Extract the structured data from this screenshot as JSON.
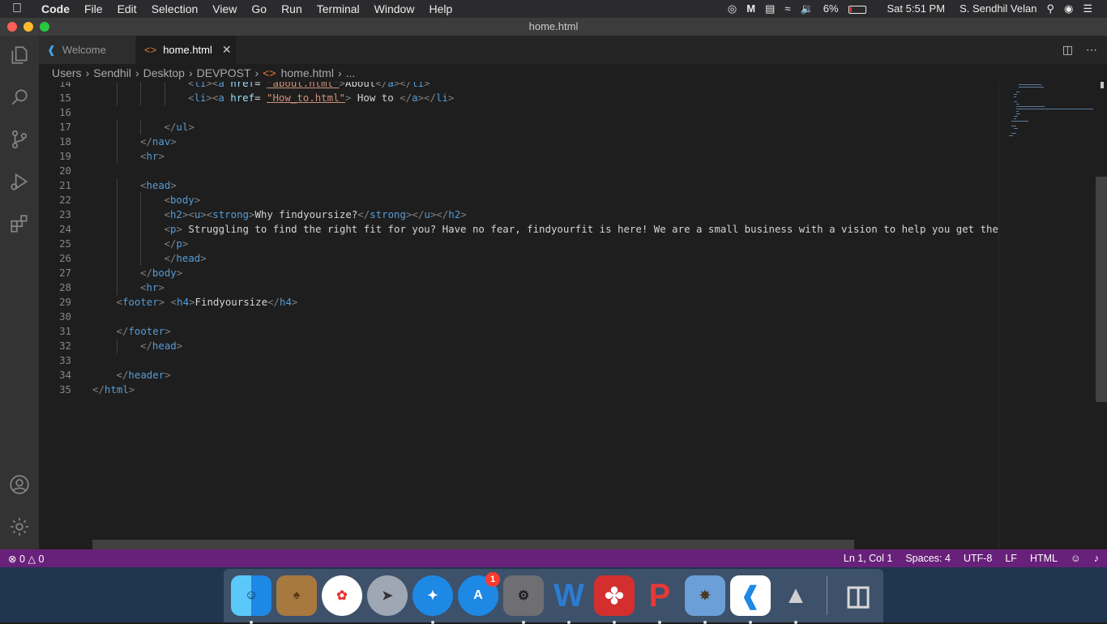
{
  "menubar": {
    "app_name": "Code",
    "menus": [
      "File",
      "Edit",
      "Selection",
      "View",
      "Go",
      "Run",
      "Terminal",
      "Window",
      "Help"
    ],
    "battery_percent": "6%",
    "clock": "Sat 5:51 PM",
    "user": "S. Sendhil Velan"
  },
  "window": {
    "title": "home.html"
  },
  "tabs": [
    {
      "label": "Welcome",
      "icon": "vscode-logo-icon",
      "active": false
    },
    {
      "label": "home.html",
      "icon": "html-file-icon",
      "active": true
    }
  ],
  "breadcrumb": [
    "Users",
    "Sendhil",
    "Desktop",
    "DEVPOST",
    "home.html",
    "..."
  ],
  "editor": {
    "lines": [
      {
        "n": "14",
        "indent": 4,
        "tokens": [
          [
            "br",
            "<"
          ],
          [
            "tag",
            "li"
          ],
          [
            "br",
            ">"
          ],
          [
            "br",
            "<"
          ],
          [
            "tag",
            "a "
          ],
          [
            "attr",
            "href"
          ],
          [
            "txt",
            "= "
          ],
          [
            "str",
            "\"about.html\""
          ],
          [
            "br",
            ">"
          ],
          [
            "txt",
            "About"
          ],
          [
            "br",
            "</"
          ],
          [
            "tag",
            "a"
          ],
          [
            "br",
            "></"
          ],
          [
            "tag",
            "li"
          ],
          [
            "br",
            ">"
          ]
        ]
      },
      {
        "n": "15",
        "indent": 4,
        "tokens": [
          [
            "br",
            "<"
          ],
          [
            "tag",
            "li"
          ],
          [
            "br",
            ">"
          ],
          [
            "br",
            "<"
          ],
          [
            "tag",
            "a "
          ],
          [
            "attr",
            "href"
          ],
          [
            "txt",
            "= "
          ],
          [
            "str",
            "\"How_to.html\""
          ],
          [
            "br",
            ">"
          ],
          [
            "txt",
            " How to "
          ],
          [
            "br",
            "</"
          ],
          [
            "tag",
            "a"
          ],
          [
            "br",
            "></"
          ],
          [
            "tag",
            "li"
          ],
          [
            "br",
            ">"
          ]
        ]
      },
      {
        "n": "16",
        "indent": 0,
        "tokens": []
      },
      {
        "n": "17",
        "indent": 3,
        "tokens": [
          [
            "br",
            "</"
          ],
          [
            "tag",
            "ul"
          ],
          [
            "br",
            ">"
          ]
        ]
      },
      {
        "n": "18",
        "indent": 2,
        "tokens": [
          [
            "br",
            "</"
          ],
          [
            "tag",
            "nav"
          ],
          [
            "br",
            ">"
          ]
        ]
      },
      {
        "n": "19",
        "indent": 2,
        "tokens": [
          [
            "br",
            "<"
          ],
          [
            "tag",
            "hr"
          ],
          [
            "br",
            ">"
          ]
        ]
      },
      {
        "n": "20",
        "indent": 0,
        "tokens": []
      },
      {
        "n": "21",
        "indent": 2,
        "tokens": [
          [
            "br",
            "<"
          ],
          [
            "tag",
            "head"
          ],
          [
            "br",
            ">"
          ]
        ]
      },
      {
        "n": "22",
        "indent": 3,
        "tokens": [
          [
            "br",
            "<"
          ],
          [
            "tag",
            "body"
          ],
          [
            "br",
            ">"
          ]
        ]
      },
      {
        "n": "23",
        "indent": 3,
        "tokens": [
          [
            "br",
            "<"
          ],
          [
            "tag",
            "h2"
          ],
          [
            "br",
            ">"
          ],
          [
            "br",
            "<"
          ],
          [
            "tag",
            "u"
          ],
          [
            "br",
            ">"
          ],
          [
            "br",
            "<"
          ],
          [
            "tag",
            "strong"
          ],
          [
            "br",
            ">"
          ],
          [
            "txt",
            "Why findyoursize?"
          ],
          [
            "br",
            "</"
          ],
          [
            "tag",
            "strong"
          ],
          [
            "br",
            "></"
          ],
          [
            "tag",
            "u"
          ],
          [
            "br",
            "></"
          ],
          [
            "tag",
            "h2"
          ],
          [
            "br",
            ">"
          ]
        ]
      },
      {
        "n": "24",
        "indent": 3,
        "tokens": [
          [
            "br",
            "<"
          ],
          [
            "tag",
            "p"
          ],
          [
            "br",
            ">"
          ],
          [
            "txt",
            " Struggling to find the right fit for you? Have no fear, findyourfit is here! We are a small business with a vision to help you get the best"
          ]
        ]
      },
      {
        "n": "25",
        "indent": 3,
        "tokens": [
          [
            "br",
            "</"
          ],
          [
            "tag",
            "p"
          ],
          [
            "br",
            ">"
          ]
        ]
      },
      {
        "n": "26",
        "indent": 3,
        "tokens": [
          [
            "br",
            "</"
          ],
          [
            "tag",
            "head"
          ],
          [
            "br",
            ">"
          ]
        ]
      },
      {
        "n": "27",
        "indent": 2,
        "tokens": [
          [
            "br",
            "</"
          ],
          [
            "tag",
            "body"
          ],
          [
            "br",
            ">"
          ]
        ]
      },
      {
        "n": "28",
        "indent": 2,
        "tokens": [
          [
            "br",
            "<"
          ],
          [
            "tag",
            "hr"
          ],
          [
            "br",
            ">"
          ]
        ]
      },
      {
        "n": "29",
        "indent": 1,
        "tokens": [
          [
            "br",
            "<"
          ],
          [
            "tag",
            "footer"
          ],
          [
            "br",
            ">"
          ],
          [
            "txt",
            " "
          ],
          [
            "br",
            "<"
          ],
          [
            "tag",
            "h4"
          ],
          [
            "br",
            ">"
          ],
          [
            "txt",
            "Findyoursize"
          ],
          [
            "br",
            "</"
          ],
          [
            "tag",
            "h4"
          ],
          [
            "br",
            ">"
          ]
        ]
      },
      {
        "n": "30",
        "indent": 0,
        "tokens": []
      },
      {
        "n": "31",
        "indent": 1,
        "tokens": [
          [
            "br",
            "</"
          ],
          [
            "tag",
            "footer"
          ],
          [
            "br",
            ">"
          ]
        ]
      },
      {
        "n": "32",
        "indent": 2,
        "tokens": [
          [
            "br",
            "</"
          ],
          [
            "tag",
            "head"
          ],
          [
            "br",
            ">"
          ]
        ]
      },
      {
        "n": "33",
        "indent": 0,
        "tokens": []
      },
      {
        "n": "34",
        "indent": 1,
        "tokens": [
          [
            "br",
            "</"
          ],
          [
            "tag",
            "header"
          ],
          [
            "br",
            ">"
          ]
        ]
      },
      {
        "n": "35",
        "indent": 0,
        "tokens": [
          [
            "br",
            "</"
          ],
          [
            "tag",
            "html"
          ],
          [
            "br",
            ">"
          ]
        ]
      }
    ]
  },
  "statusbar": {
    "errors": "0",
    "warnings": "0",
    "cursor": "Ln 1, Col 1",
    "spaces": "Spaces: 4",
    "encoding": "UTF-8",
    "eol": "LF",
    "language": "HTML"
  },
  "dock": {
    "items": [
      {
        "name": "finder",
        "running": true
      },
      {
        "name": "contacts",
        "running": false
      },
      {
        "name": "photos",
        "running": false
      },
      {
        "name": "launchpad",
        "running": false
      },
      {
        "name": "safari",
        "running": true
      },
      {
        "name": "app-store",
        "running": false,
        "badge": "1"
      },
      {
        "name": "system-preferences",
        "running": true
      },
      {
        "name": "word",
        "running": true
      },
      {
        "name": "acrobat",
        "running": true
      },
      {
        "name": "powerpoint",
        "running": true
      },
      {
        "name": "preview",
        "running": true
      },
      {
        "name": "vscode",
        "running": true
      },
      {
        "name": "rocket",
        "running": true
      },
      {
        "name": "trash",
        "running": false
      }
    ]
  }
}
